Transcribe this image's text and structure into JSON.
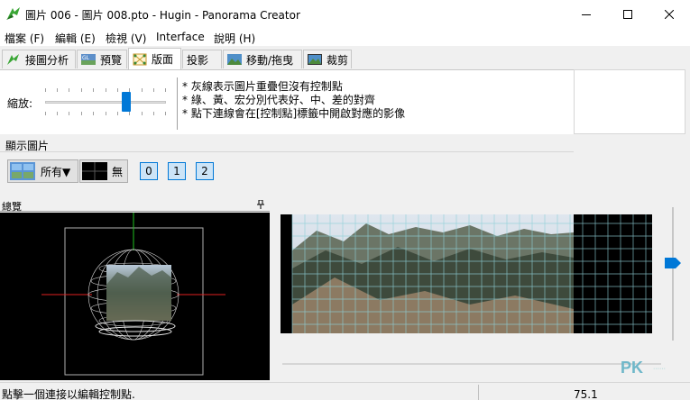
{
  "window": {
    "title": "圖片 006 - 圖片 008.pto - Hugin - Panorama Creator",
    "icon": "hugin-app-icon"
  },
  "menu": [
    {
      "label": "檔案 (F)"
    },
    {
      "label": "編輯 (E)"
    },
    {
      "label": "檢視 (V)"
    },
    {
      "label": "Interface"
    },
    {
      "label": "說明 (H)"
    }
  ],
  "tabs": [
    {
      "label": "接圖分析",
      "icon": "stitch-icon",
      "active": false
    },
    {
      "label": "預覽",
      "icon": "gl-preview-icon",
      "active": false
    },
    {
      "label": "版面",
      "icon": "layout-icon",
      "active": true
    },
    {
      "label": "投影",
      "icon": "",
      "active": false
    },
    {
      "label": "移動/拖曳",
      "icon": "move-icon",
      "active": false
    },
    {
      "label": "裁剪",
      "icon": "crop-icon",
      "active": false
    }
  ],
  "layout_panel": {
    "zoom_label": "縮放:",
    "zoom_value": 0.67,
    "notes": [
      "* 灰線表示圖片重疊但沒有控制點",
      "* 綠、黃、宏分別代表好、中、差的對齊",
      "* 點下連線會在[控制點]標籤中開啟對應的影像"
    ]
  },
  "show_images": {
    "label": "顯示圖片",
    "all_label": "所有▼",
    "none_label": "無",
    "image_buttons": [
      "0",
      "1",
      "2"
    ]
  },
  "overview": {
    "title": "總覽"
  },
  "status": {
    "text": "點擊一個連接以編輯控制點.",
    "value": "75.1"
  },
  "watermark": {
    "text": "PK",
    "sub": "······"
  },
  "colors": {
    "accent": "#0078d7",
    "axis_red": "#e02020",
    "axis_green": "#20c020",
    "grid": "#8fd0d8"
  }
}
